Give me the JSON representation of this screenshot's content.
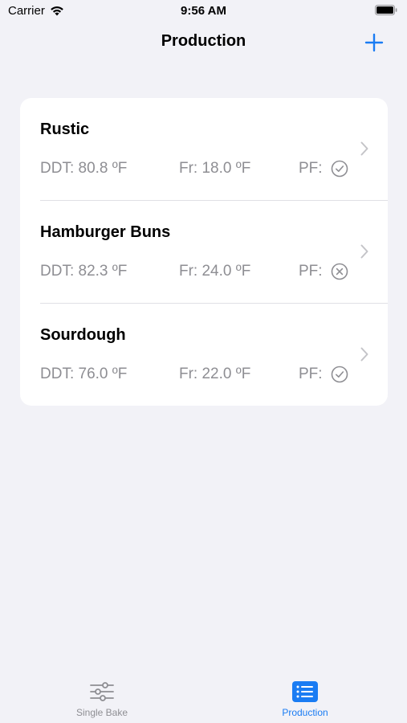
{
  "status": {
    "carrier": "Carrier",
    "time": "9:56 AM"
  },
  "nav": {
    "title": "Production",
    "add_icon": "plus-icon"
  },
  "colors": {
    "accent": "#1a7cf3",
    "secondary_text": "#8e8e93",
    "background": "#f2f2f7"
  },
  "rows": [
    {
      "title": "Rustic",
      "ddt": "DDT: 80.8 ºF",
      "fr": "Fr: 18.0 ºF",
      "pf_label": "PF:",
      "pf_icon": "checkmark-circle-icon"
    },
    {
      "title": "Hamburger Buns",
      "ddt": "DDT: 82.3 ºF",
      "fr": "Fr: 24.0 ºF",
      "pf_label": "PF:",
      "pf_icon": "x-circle-icon"
    },
    {
      "title": "Sourdough",
      "ddt": "DDT: 76.0 ºF",
      "fr": "Fr: 22.0 ºF",
      "pf_label": "PF:",
      "pf_icon": "checkmark-circle-icon"
    }
  ],
  "tabs": [
    {
      "label": "Single Bake",
      "icon": "sliders-icon",
      "selected": false
    },
    {
      "label": "Production",
      "icon": "list-icon",
      "selected": true
    }
  ]
}
